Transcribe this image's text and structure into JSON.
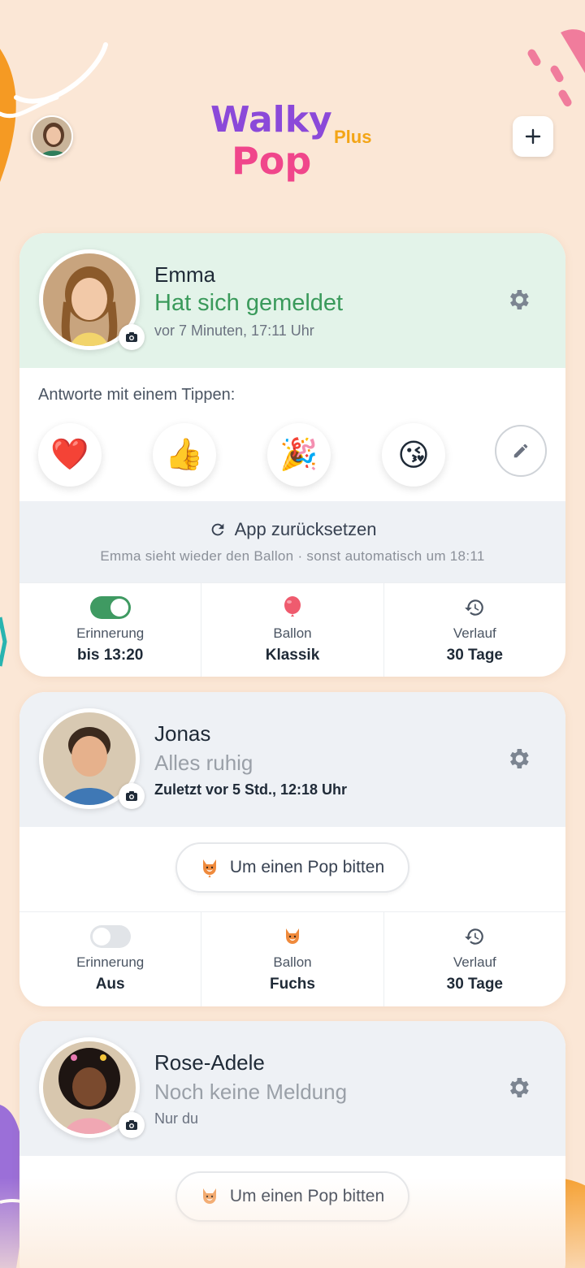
{
  "header": {
    "logo_word1": "Walky",
    "logo_word2": "Pop",
    "logo_plus": "Plus",
    "add_icon": "plus-icon"
  },
  "colors": {
    "background": "#fbe7d6",
    "accent_green": "#3a9a5b",
    "toggle_on": "#3f9a62",
    "logo_plus": "#f3a516"
  },
  "cards": [
    {
      "name": "Emma",
      "status": "Hat sich gemeldet",
      "subtitle": "vor 7 Minuten, 17:11 Uhr",
      "quick_reply_label": "Antworte mit einem Tippen:",
      "reactions": [
        "❤️",
        "👍",
        "🎉",
        "😘"
      ],
      "reset_title": "App zurücksetzen",
      "reset_subtitle": "Emma sieht wieder den Ballon · sonst automatisch um 18:11",
      "stats": [
        {
          "label": "Erinnerung",
          "value": "bis 13:20",
          "toggle": "on"
        },
        {
          "label": "Ballon",
          "value": "Klassik",
          "icon": "red-balloon-icon"
        },
        {
          "label": "Verlauf",
          "value": "30 Tage",
          "icon": "history-icon"
        }
      ]
    },
    {
      "name": "Jonas",
      "status": "Alles ruhig",
      "subtitle": "Zuletzt vor 5 Std., 12:18 Uhr",
      "pop_button": "Um einen Pop bitten",
      "stats": [
        {
          "label": "Erinnerung",
          "value": "Aus",
          "toggle": "off"
        },
        {
          "label": "Ballon",
          "value": "Fuchs",
          "icon": "fox-balloon-icon"
        },
        {
          "label": "Verlauf",
          "value": "30 Tage",
          "icon": "history-icon"
        }
      ]
    },
    {
      "name": "Rose-Adele",
      "status": "Noch keine Meldung",
      "subtitle": "Nur du",
      "pop_button": "Um einen Pop bitten"
    }
  ]
}
